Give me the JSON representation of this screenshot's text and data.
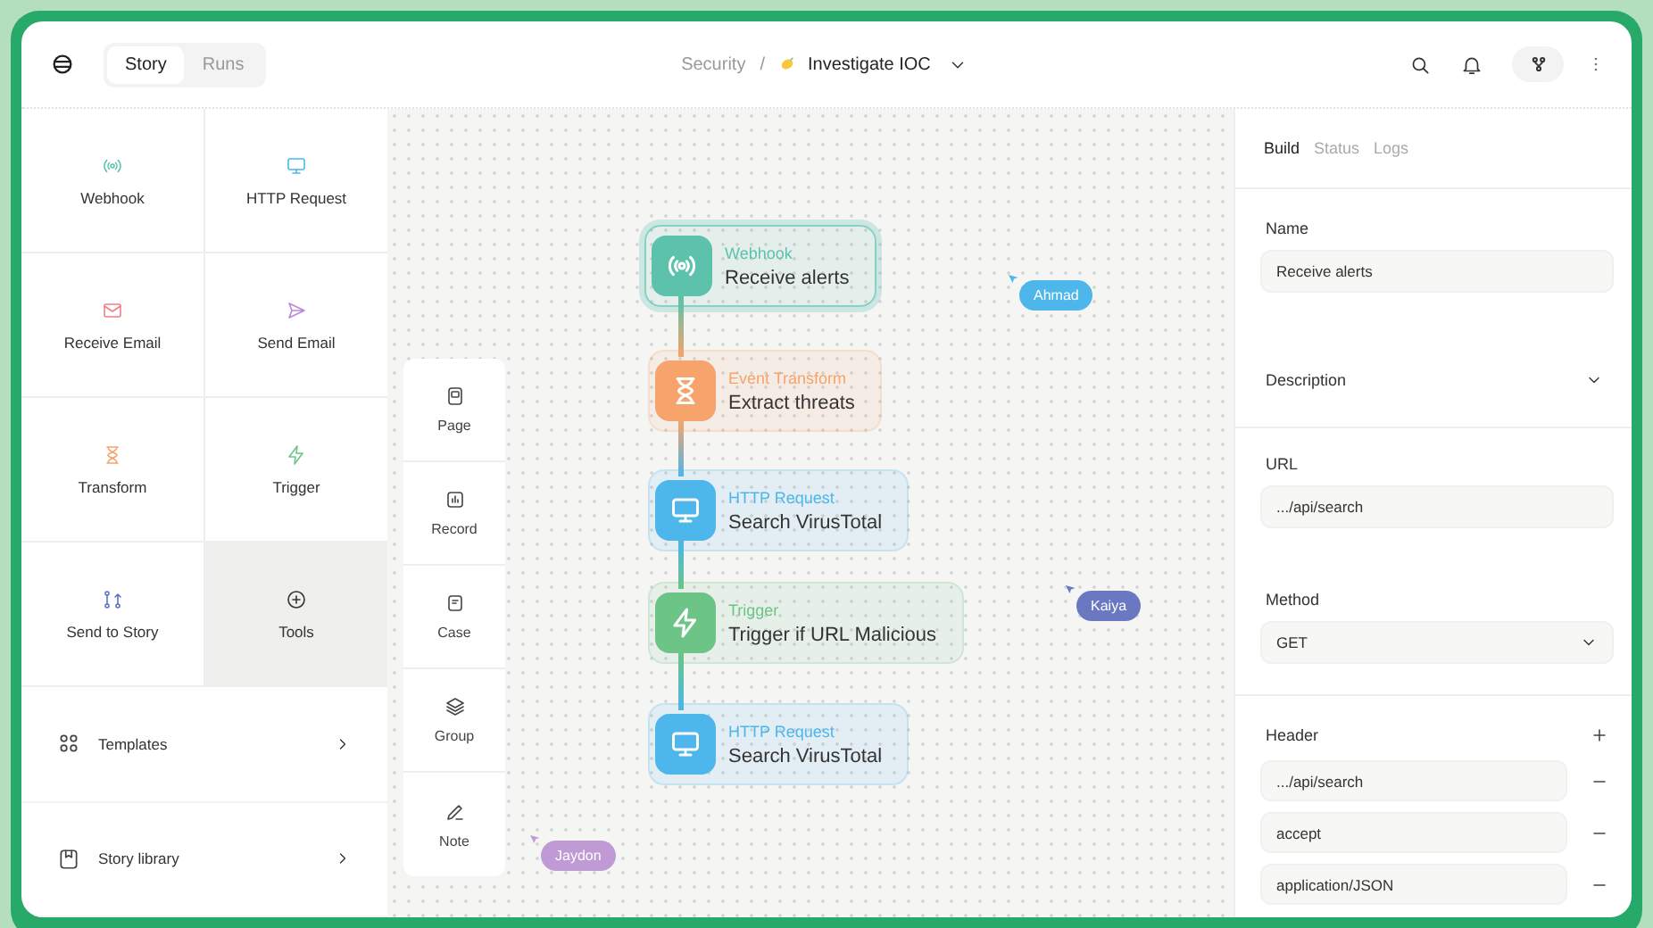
{
  "header": {
    "tabs": [
      {
        "label": "Story",
        "selected": true
      },
      {
        "label": "Runs",
        "selected": false
      }
    ],
    "breadcrumb": {
      "parent": "Security",
      "separator": "/",
      "story": "Investigate IOC"
    }
  },
  "actions": [
    {
      "kind": "webhook",
      "label": "Webhook",
      "selected": false
    },
    {
      "kind": "http",
      "label": "HTTP Request",
      "selected": false
    },
    {
      "kind": "receive-email",
      "label": "Receive Email",
      "selected": false
    },
    {
      "kind": "send-email",
      "label": "Send Email",
      "selected": false
    },
    {
      "kind": "transform",
      "label": "Transform",
      "selected": false
    },
    {
      "kind": "trigger",
      "label": "Trigger",
      "selected": false
    },
    {
      "kind": "send-to-story",
      "label": "Send to Story",
      "selected": false
    },
    {
      "kind": "tools",
      "label": "Tools",
      "selected": true
    }
  ],
  "library_links": [
    {
      "kind": "templates",
      "label": "Templates"
    },
    {
      "kind": "library",
      "label": "Story library"
    }
  ],
  "palette": [
    {
      "kind": "page",
      "label": "Page"
    },
    {
      "kind": "record",
      "label": "Record"
    },
    {
      "kind": "case",
      "label": "Case"
    },
    {
      "kind": "group",
      "label": "Group"
    },
    {
      "kind": "note",
      "label": "Note"
    }
  ],
  "nodes": [
    {
      "kind": "webhook",
      "type_label": "Webhook",
      "name": "Receive alerts",
      "selected": true
    },
    {
      "kind": "transform",
      "type_label": "Event Transform",
      "name": "Extract threats",
      "selected": false
    },
    {
      "kind": "http",
      "type_label": "HTTP Request",
      "name": "Search VirusTotal",
      "selected": false
    },
    {
      "kind": "trigger",
      "type_label": "Trigger",
      "name": "Trigger if URL Malicious",
      "selected": false
    },
    {
      "kind": "http",
      "type_label": "HTTP Request",
      "name": "Search VirusTotal",
      "selected": false
    }
  ],
  "cursors": [
    {
      "name": "Ahmad",
      "color": "#4db6ea"
    },
    {
      "name": "Kaiya",
      "color": "#6a78c2"
    },
    {
      "name": "Jaydon",
      "color": "#c09ad4"
    }
  ],
  "inspector": {
    "tabs": [
      {
        "label": "Build",
        "selected": true
      },
      {
        "label": "Status",
        "selected": false
      },
      {
        "label": "Logs",
        "selected": false
      }
    ],
    "name": {
      "label": "Name",
      "value": "Receive alerts"
    },
    "description": {
      "label": "Description",
      "expanded": false
    },
    "url": {
      "label": "URL",
      "value": ".../api/search"
    },
    "method": {
      "label": "Method",
      "value": "GET"
    },
    "header": {
      "label": "Header",
      "rows": [
        ".../api/search",
        "accept",
        "application/JSON"
      ]
    }
  }
}
